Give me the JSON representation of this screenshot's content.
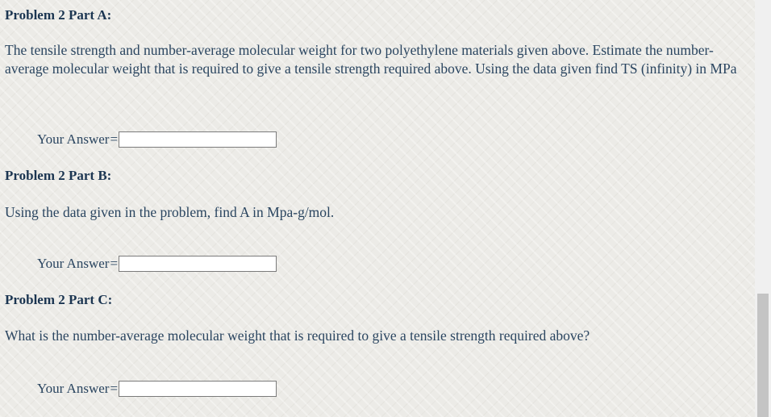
{
  "part_a": {
    "heading": "Problem 2 Part A:",
    "question": "The tensile strength and number-average molecular weight for two polyethylene materials given above. Estimate the number-average molecular weight that is required to give a tensile strength required above. Using the data given find TS (infinity) in MPa",
    "answer_label": "Your Answer",
    "answer_equals": "=",
    "answer_value": ""
  },
  "part_b": {
    "heading": "Problem 2 Part B:",
    "question": "Using the data given in the problem, find A in Mpa-g/mol.",
    "answer_label": "Your Answer",
    "answer_equals": "=",
    "answer_value": ""
  },
  "part_c": {
    "heading": "Problem 2 Part C:",
    "question": "What is the number-average molecular weight that is required to give a tensile strength required above?",
    "answer_label": "Your Answer",
    "answer_equals": "=",
    "answer_value": ""
  }
}
